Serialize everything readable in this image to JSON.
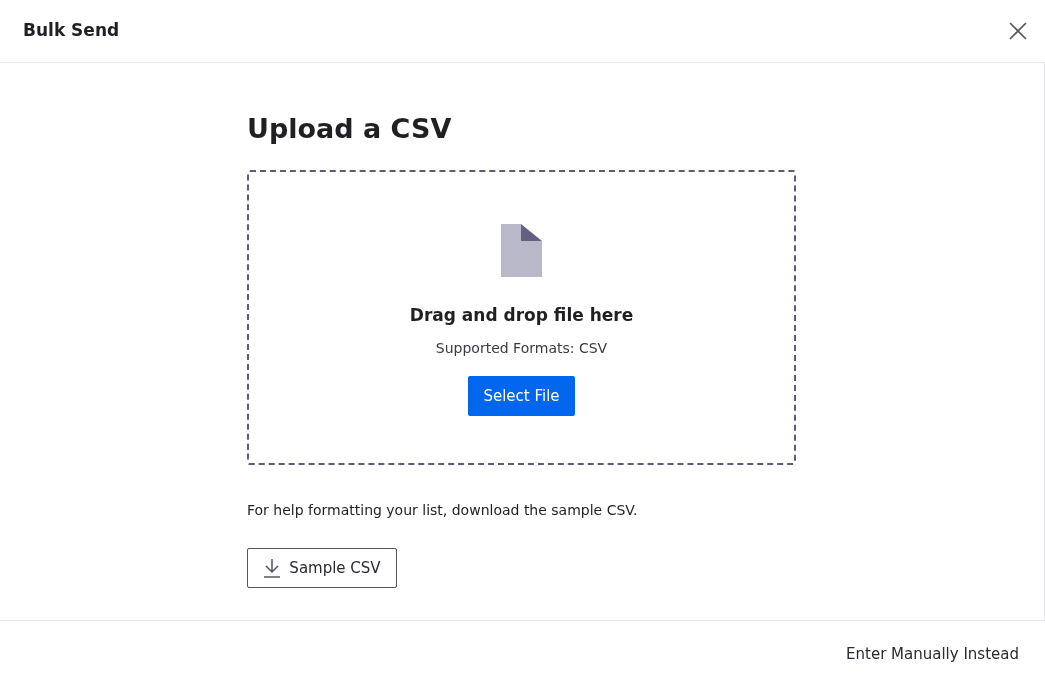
{
  "dialog": {
    "title": "Bulk Send"
  },
  "upload": {
    "heading": "Upload a CSV",
    "dropzone": {
      "title": "Drag and drop file here",
      "formats": "Supported Formats: CSV",
      "button": "Select File"
    },
    "help_text": "For help formatting your list, download the sample CSV.",
    "sample_button": "Sample CSV"
  },
  "footer": {
    "link": "Enter Manually Instead"
  }
}
